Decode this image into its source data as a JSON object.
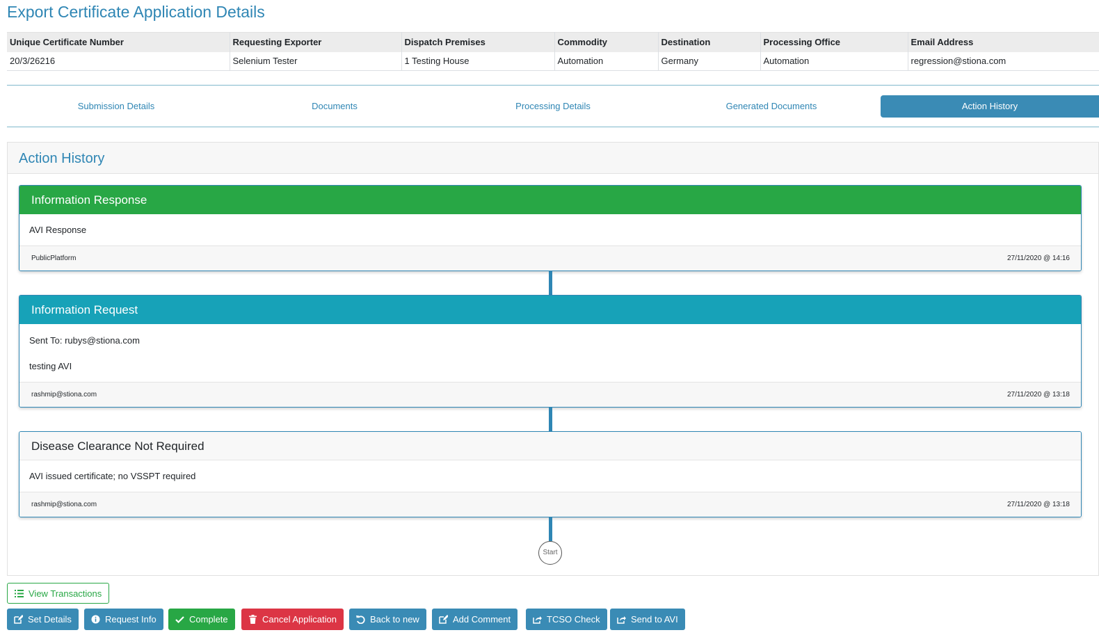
{
  "page_title": "Export Certificate Application Details",
  "summary": {
    "headers": [
      "Unique Certificate Number",
      "Requesting Exporter",
      "Dispatch Premises",
      "Commodity",
      "Destination",
      "Processing Office",
      "Email Address"
    ],
    "values": [
      "20/3/26216",
      "Selenium Tester",
      "1 Testing House",
      "Automation",
      "Germany",
      "Automation",
      "regression@stiona.com"
    ]
  },
  "tabs": [
    {
      "label": "Submission Details"
    },
    {
      "label": "Documents"
    },
    {
      "label": "Processing Details"
    },
    {
      "label": "Generated Documents"
    },
    {
      "label": "Action History",
      "active": true
    }
  ],
  "panel_title": "Action History",
  "history": [
    {
      "title": "Information Response",
      "style_color": "#28a745",
      "lines": [
        "AVI Response"
      ],
      "user": "PublicPlatform",
      "timestamp": "27/11/2020 @ 14:16"
    },
    {
      "title": "Information Request",
      "style_color": "#17a2b8",
      "lines": [
        "Sent To: rubys@stiona.com",
        "testing AVI"
      ],
      "user": "rashmip@stiona.com",
      "timestamp": "27/11/2020 @ 13:18"
    },
    {
      "title": "Disease Clearance Not Required",
      "style_color": "#f8f8f8",
      "lines": [
        "AVI issued certificate; no VSSPT required"
      ],
      "user": "rashmip@stiona.com",
      "timestamp": "27/11/2020 @ 13:18"
    }
  ],
  "start_label": "Start",
  "buttons": {
    "view_transactions": "View Transactions",
    "set_details": "Set Details",
    "request_info": "Request Info",
    "complete": "Complete",
    "cancel_application": "Cancel Application",
    "back_to_new": "Back to new",
    "add_comment": "Add Comment",
    "tcso_check": "TCSO Check",
    "send_to_avi": "Send to AVI"
  },
  "colors": {
    "accent": "#2f86b4",
    "success": "#28a745",
    "info": "#17a2b8",
    "danger": "#dc3545"
  }
}
